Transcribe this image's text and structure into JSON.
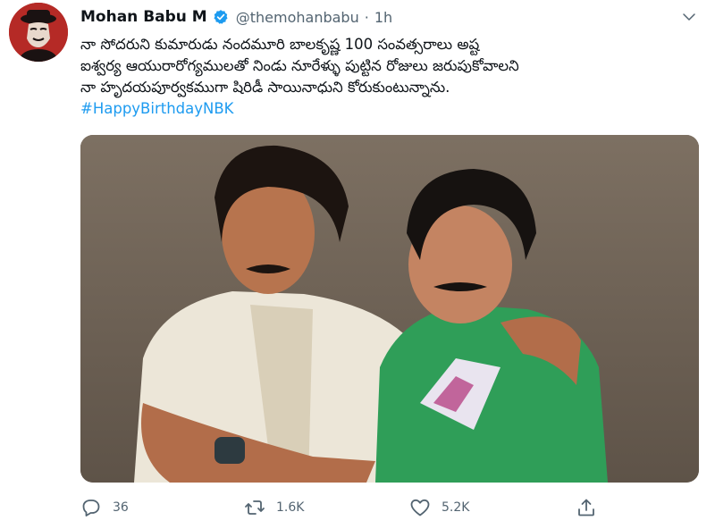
{
  "tweet": {
    "author_name": "Mohan Babu M",
    "handle": "@themohanbabu",
    "separator": "·",
    "time": "1h",
    "text_lines": [
      "నా సోదరుని కుమారుడు నందమూరి బాలకృష్ణ 100 సంవత్సరాలు అష్ట",
      "ఐశ్వర్య ఆయురారోగ్యములతో నిండు నూరేళ్ళు పుట్టిన రోజులు జరుపుకోవాలని",
      "నా హృదయపూర్వకముగా షిరిడీ సాయినాధుని కోరుకుంటున్నాను."
    ],
    "hashtag": "#HappyBirthdayNBK",
    "replies": "36",
    "retweets": "1.6K",
    "likes": "5.2K"
  },
  "icons": {
    "avatar": "profile-silhouette",
    "verified": "verified-badge-icon",
    "more": "chevron-down-icon",
    "reply": "reply-icon",
    "retweet": "retweet-icon",
    "like": "heart-icon",
    "share": "share-icon"
  },
  "colors": {
    "verified": "#1d9bf0",
    "hashtag": "#1d9bf0",
    "muted": "#536471",
    "avatar_bg": "#b52a26"
  }
}
